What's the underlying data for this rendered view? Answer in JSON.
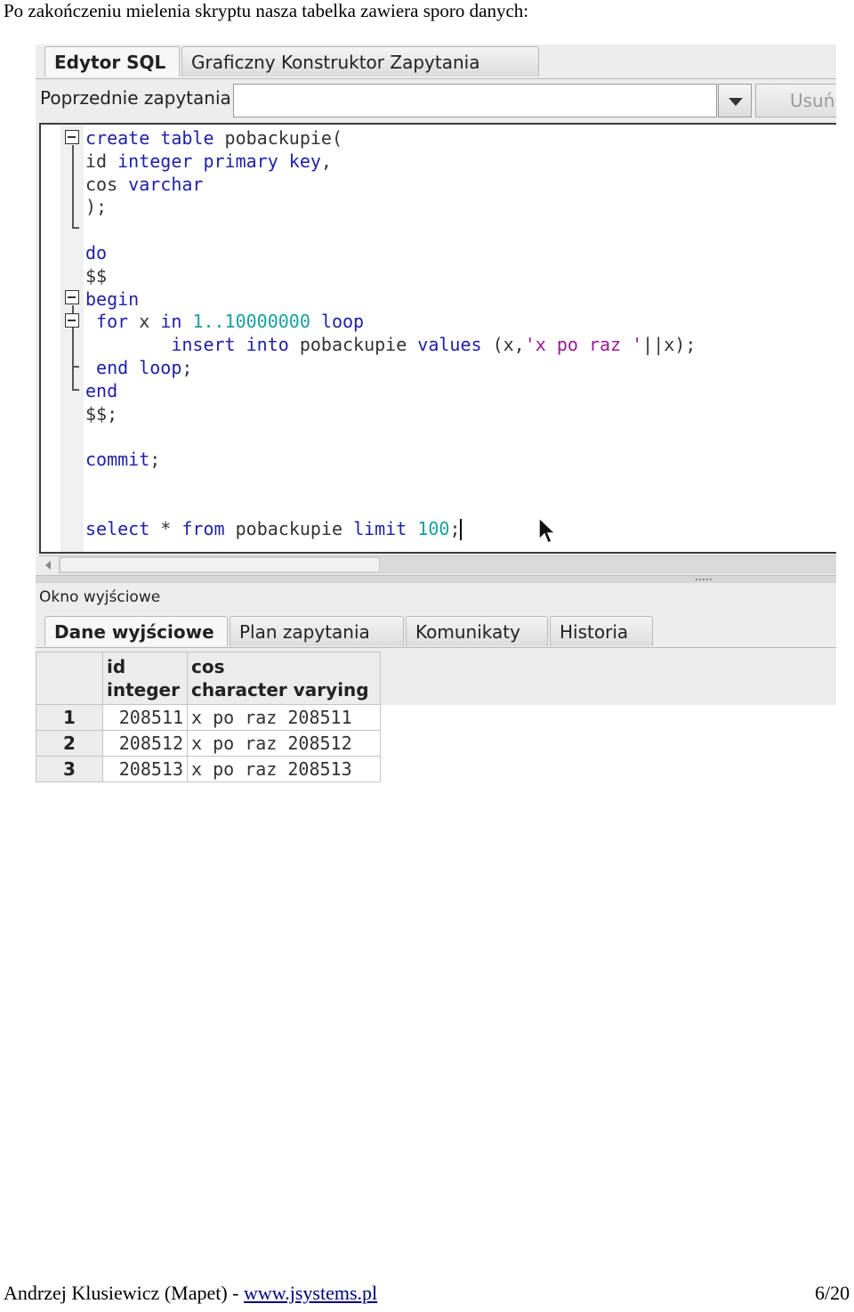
{
  "document": {
    "heading": "Po zakończeniu mielenia skryptu nasza tabelka zawiera sporo danych:",
    "footer_author": "Andrzej Klusiewicz (Mapet)  - ",
    "footer_link": "www.jsystems.pl",
    "page_number": "6/20"
  },
  "editor_tabs": [
    {
      "label": "Edytor SQL",
      "active": true
    },
    {
      "label": "Graficzny Konstruktor Zapytania",
      "active": false
    }
  ],
  "previous_queries": {
    "label": "Poprzednie zapytania",
    "value": "",
    "delete_label": "Usuń"
  },
  "sql_lines": [
    {
      "segments": [
        {
          "t": "create table ",
          "c": "kw"
        },
        {
          "t": "pobackupie(",
          "c": ""
        }
      ]
    },
    {
      "segments": [
        {
          "t": "id ",
          "c": ""
        },
        {
          "t": "integer primary key",
          "c": "kw"
        },
        {
          "t": ",",
          "c": ""
        }
      ]
    },
    {
      "segments": [
        {
          "t": "cos ",
          "c": ""
        },
        {
          "t": "varchar",
          "c": "kw"
        }
      ]
    },
    {
      "segments": [
        {
          "t": ");",
          "c": ""
        }
      ]
    },
    {
      "segments": []
    },
    {
      "segments": [
        {
          "t": "do",
          "c": "kw"
        }
      ]
    },
    {
      "segments": [
        {
          "t": "$$",
          "c": ""
        }
      ]
    },
    {
      "segments": [
        {
          "t": "begin",
          "c": "kw"
        }
      ]
    },
    {
      "segments": [
        {
          "t": " for ",
          "c": "kw"
        },
        {
          "t": "x ",
          "c": ""
        },
        {
          "t": "in ",
          "c": "kw"
        },
        {
          "t": "1..10000000 ",
          "c": "num"
        },
        {
          "t": "loop",
          "c": "kw"
        }
      ]
    },
    {
      "segments": [
        {
          "t": "        insert into ",
          "c": "kw"
        },
        {
          "t": "pobackupie ",
          "c": ""
        },
        {
          "t": "values ",
          "c": "kw"
        },
        {
          "t": "(x,",
          "c": ""
        },
        {
          "t": "'x po raz '",
          "c": "str"
        },
        {
          "t": "||x);",
          "c": ""
        }
      ]
    },
    {
      "segments": [
        {
          "t": " end loop",
          "c": "kw"
        },
        {
          "t": ";",
          "c": ""
        }
      ]
    },
    {
      "segments": [
        {
          "t": "end",
          "c": "kw"
        }
      ]
    },
    {
      "segments": [
        {
          "t": "$$;",
          "c": ""
        }
      ]
    },
    {
      "segments": []
    },
    {
      "segments": [
        {
          "t": "commit",
          "c": "kw"
        },
        {
          "t": ";",
          "c": ""
        }
      ]
    },
    {
      "segments": []
    },
    {
      "segments": []
    },
    {
      "segments": [
        {
          "t": "select ",
          "c": "kw"
        },
        {
          "t": "* ",
          "c": ""
        },
        {
          "t": "from ",
          "c": "kw"
        },
        {
          "t": "pobackupie ",
          "c": ""
        },
        {
          "t": "limit ",
          "c": "kw"
        },
        {
          "t": "100",
          "c": "num"
        },
        {
          "t": ";",
          "c": ""
        }
      ],
      "caret": true
    }
  ],
  "output": {
    "label": "Okno wyjściowe",
    "tabs": [
      {
        "label": "Dane wyjściowe",
        "active": true
      },
      {
        "label": "Plan zapytania",
        "active": false
      },
      {
        "label": "Komunikaty",
        "active": false
      },
      {
        "label": "Historia",
        "active": false
      }
    ],
    "columns": [
      {
        "name": "id",
        "type": "integer"
      },
      {
        "name": "cos",
        "type": "character varying"
      }
    ],
    "rows": [
      {
        "num": "1",
        "id": "208511",
        "cos": "x po raz 208511"
      },
      {
        "num": "2",
        "id": "208512",
        "cos": "x po raz 208512"
      },
      {
        "num": "3",
        "id": "208513",
        "cos": "x po raz 208513"
      }
    ]
  },
  "icons": {
    "fold": "fold-collapse-icon",
    "dropdown": "chevron-down-icon",
    "scroll_left": "arrow-left-icon",
    "cursor": "mouse-cursor-icon"
  },
  "colors": {
    "keyword": "#1f1fa8",
    "number": "#18a0a0",
    "string": "#9a1a9a",
    "link": "#000080"
  }
}
